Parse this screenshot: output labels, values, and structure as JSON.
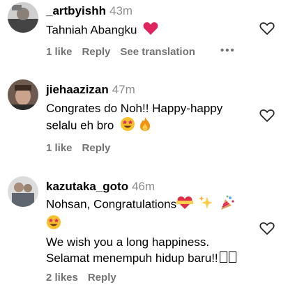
{
  "comments": [
    {
      "username": "_artbyishh",
      "time": "43m",
      "lines": [
        "Tahniah Abangku"
      ],
      "likes": "1 like",
      "reply": "Reply",
      "translate": "See translation",
      "more": "•••"
    },
    {
      "username": "jiehaazizan",
      "time": "47m",
      "lines": [
        "Congrates do Noh!! Happy-happy",
        "selalu eh bro"
      ],
      "likes": "1 like",
      "reply": "Reply"
    },
    {
      "username": "kazutaka_goto",
      "time": "46m",
      "lines": [
        "Nohsan, Congratulations",
        "We wish you a long happiness.",
        "Selamat menempuh hidup baru!!"
      ],
      "likes": "2 likes",
      "reply": "Reply"
    }
  ],
  "colors": {
    "heart_red": "#e0245e",
    "muted": "#737373",
    "time": "#8e8e8e"
  },
  "icons": [
    "heart-emoji",
    "heart-outline-icon",
    "star-eyes-emoji",
    "fire-emoji",
    "heart-ribbon-emoji",
    "sparkles-emoji",
    "party-popper-emoji"
  ]
}
